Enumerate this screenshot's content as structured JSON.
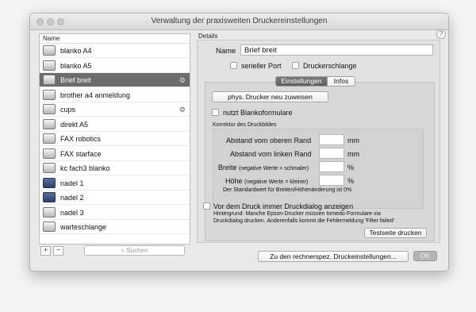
{
  "window": {
    "title": "Verwaltung der praxisweiten Druckereinstellungen"
  },
  "sidebar": {
    "header": "Name",
    "items": [
      {
        "label": "blanko A4",
        "icon": "printer-light-icon"
      },
      {
        "label": "blanko A5",
        "icon": "printer-light-icon"
      },
      {
        "label": "Brief breit",
        "icon": "printer-light-icon",
        "selected": true,
        "gear": true
      },
      {
        "label": "brother a4 anmeldung",
        "icon": "printer-light-icon"
      },
      {
        "label": "cups",
        "icon": "printer-light-icon",
        "gear": true
      },
      {
        "label": "direkt A5",
        "icon": "printer-light-icon"
      },
      {
        "label": "FAX robotics",
        "icon": "printer-light-icon"
      },
      {
        "label": "FAX starface",
        "icon": "printer-light-icon"
      },
      {
        "label": "kc fach3 blanko",
        "icon": "printer-light-icon"
      },
      {
        "label": "nadel 1",
        "icon": "printer-dark-icon"
      },
      {
        "label": "nadel 2",
        "icon": "printer-dark-icon"
      },
      {
        "label": "nadel 3",
        "icon": "printer-light-icon"
      },
      {
        "label": "warteschlange",
        "icon": "printer-light-icon"
      }
    ],
    "add_label": "+",
    "remove_label": "−",
    "search_placeholder": "Suchen"
  },
  "details": {
    "section_label": "Details",
    "name_label": "Name",
    "name_value": "Brief breit",
    "serial_port_label": "serieller Port",
    "printer_queue_label": "Druckerschlange",
    "tabs": [
      "Einstellungen",
      "Infos"
    ],
    "assign_button": "phys. Drucker neu zuweisen",
    "blank_forms_label": "nutzt Blankoformulare",
    "correction_title": "Korrektur des Druckbildes",
    "top_margin_label": "Abstand vom oberen Rand",
    "top_margin_unit": "mm",
    "left_margin_label": "Abstand vom linken Rand",
    "left_margin_unit": "mm",
    "width_label": "Breite",
    "width_hint": "(negative Werte = schmaler)",
    "width_unit": "%",
    "height_label": "Höhe",
    "height_hint": "(negative Werte = kleiner)",
    "height_unit": "%",
    "default_note": "Der Standardwert für Breiten/Höhenänderung ist 0%",
    "show_dialog_label": "Vor dem Druck immer Druckdialog anzeigen",
    "background_note_1": "Hintergrund: Manche Epson-Drucker müssen tomedo-Formulare via",
    "background_note_2": "Druckdialog drucken. Anderenfalls kommt die Fehlermeldung 'Filter failed'",
    "test_page_button": "Testseite drucken"
  },
  "footer": {
    "computer_settings_button": "Zu den rechnerspez. Druckeinstellungen...",
    "ok_button": "OK"
  },
  "help_label": "?"
}
